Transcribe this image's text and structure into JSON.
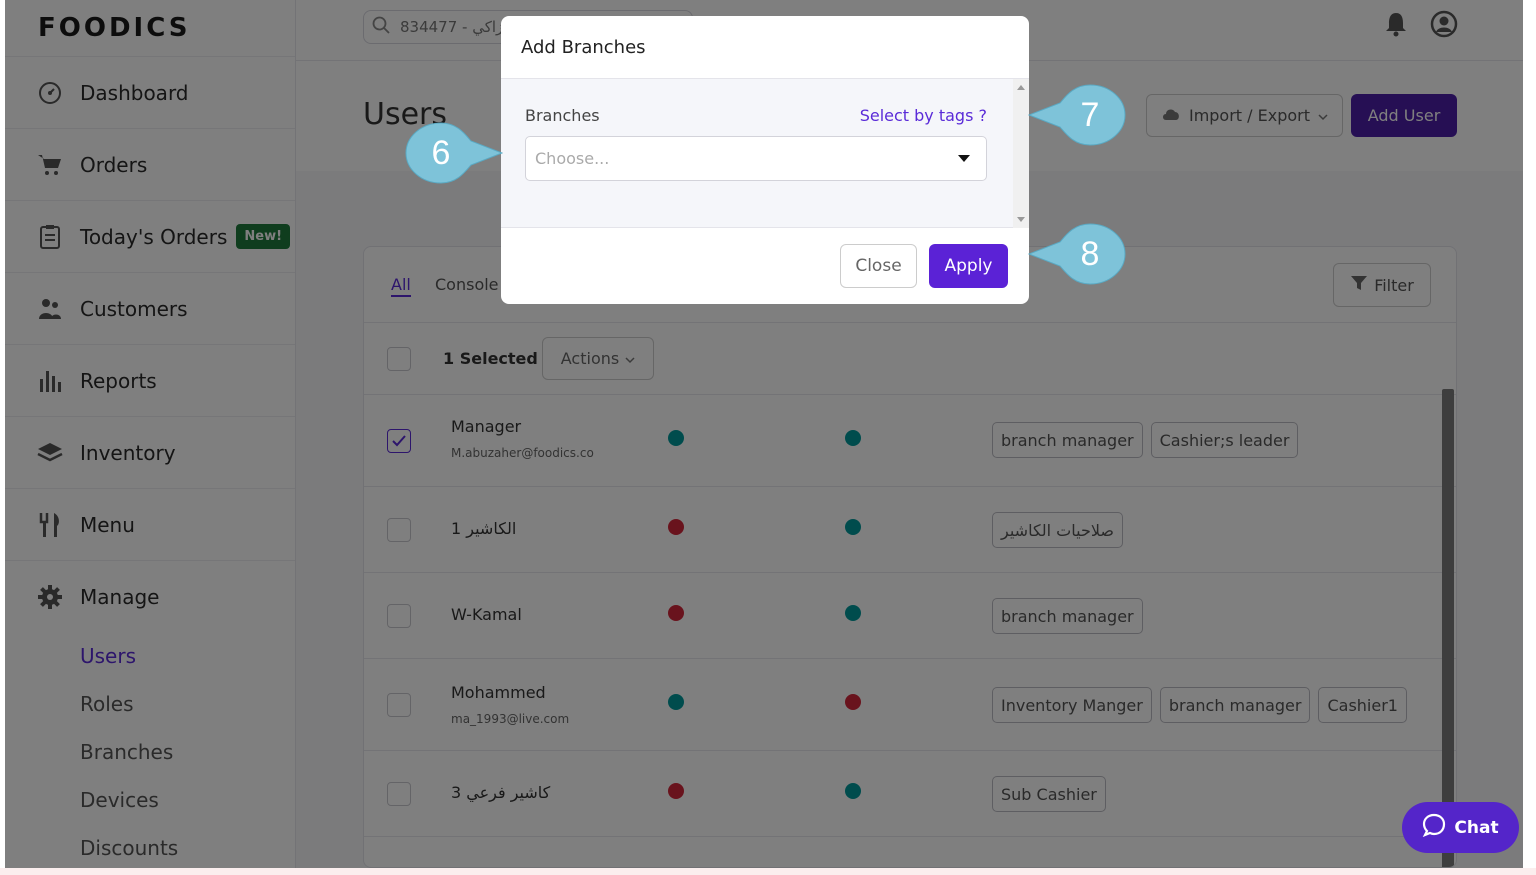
{
  "sidebar": {
    "logo": "FOODICS",
    "items": [
      {
        "label": "Dashboard",
        "icon": "gauge-icon"
      },
      {
        "label": "Orders",
        "icon": "cart-icon"
      },
      {
        "label": "Today's Orders",
        "icon": "clipboard-icon",
        "badge": "New!"
      },
      {
        "label": "Customers",
        "icon": "users-icon"
      },
      {
        "label": "Reports",
        "icon": "bar-chart-icon"
      },
      {
        "label": "Inventory",
        "icon": "layers-icon"
      },
      {
        "label": "Menu",
        "icon": "utensils-icon"
      },
      {
        "label": "Manage",
        "icon": "gear-icon"
      }
    ],
    "sub_items": [
      {
        "label": "Users",
        "active": true
      },
      {
        "label": "Roles"
      },
      {
        "label": "Branches"
      },
      {
        "label": "Devices"
      },
      {
        "label": "Discounts"
      }
    ]
  },
  "topbar": {
    "search_value": "834477 - زاكي"
  },
  "page": {
    "title": "Users",
    "import_export_label": "Import / Export",
    "add_user_label": "Add User"
  },
  "tabs": [
    {
      "label": "All",
      "active": true
    },
    {
      "label": "Console"
    }
  ],
  "filter_label": "Filter",
  "selection": {
    "label": "1 Selected",
    "actions_label": "Actions"
  },
  "rows": [
    {
      "name": "Manager",
      "email": "M.abuzaher@foodics.co",
      "checked": true,
      "dot1": "teal",
      "dot2": "teal",
      "tags": [
        "branch manager",
        "Cashier;s leader"
      ]
    },
    {
      "name": "الكاشير 1",
      "email": "",
      "checked": false,
      "dot1": "red",
      "dot2": "teal",
      "tags": [
        "صلاحيات الكاشير"
      ]
    },
    {
      "name": "W-Kamal",
      "email": "",
      "checked": false,
      "dot1": "red",
      "dot2": "teal",
      "tags": [
        "branch manager"
      ]
    },
    {
      "name": "Mohammed",
      "email": "ma_1993@live.com",
      "checked": false,
      "dot1": "teal",
      "dot2": "red",
      "tags": [
        "Inventory Manger",
        "branch manager",
        "Cashier1"
      ]
    },
    {
      "name": "كاشير فرعي 3",
      "email": "",
      "checked": false,
      "dot1": "red",
      "dot2": "teal",
      "tags": [
        "Sub Cashier"
      ]
    }
  ],
  "modal": {
    "title": "Add Branches",
    "field_label": "Branches",
    "select_by_tags": "Select by tags ?",
    "placeholder": "Choose...",
    "close_label": "Close",
    "apply_label": "Apply"
  },
  "callouts": [
    "6",
    "7",
    "8"
  ],
  "chat_label": "Chat",
  "colors": {
    "accent": "#5b22d6",
    "callout": "#7ec3d9",
    "teal": "#00999b",
    "red": "#d3263a"
  }
}
